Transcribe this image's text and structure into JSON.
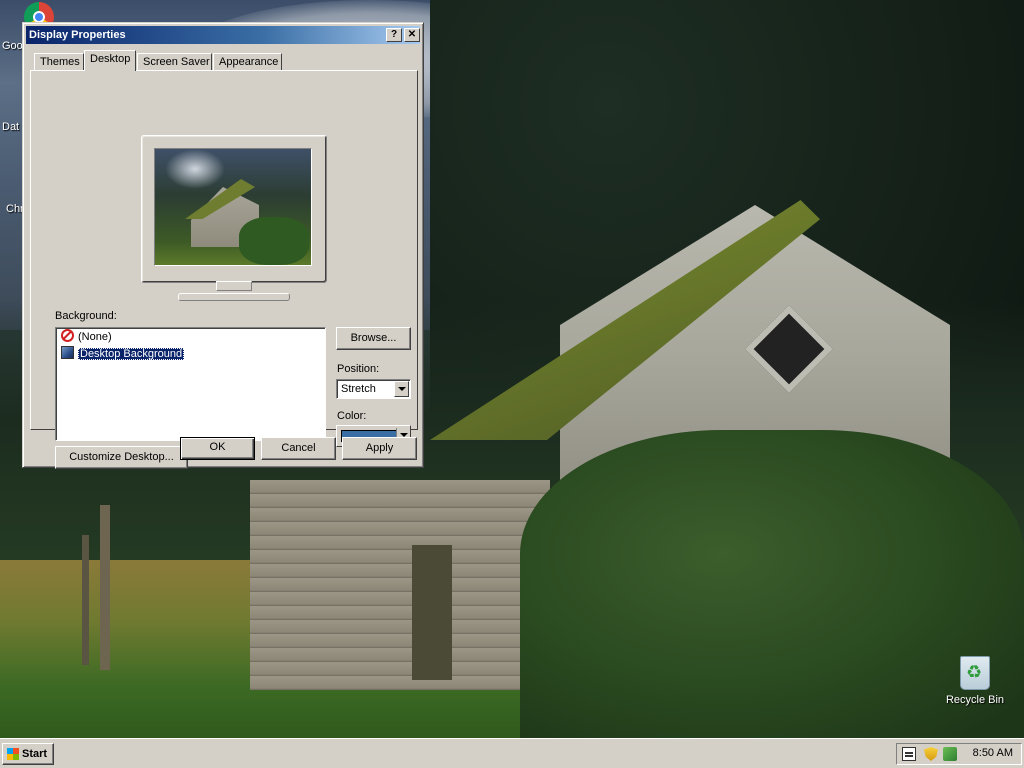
{
  "desktop": {
    "icons": [
      {
        "label": "Goo"
      },
      {
        "label": "Dat"
      },
      {
        "label": "Chr"
      }
    ],
    "recycle_bin": "Recycle Bin"
  },
  "dialog": {
    "title": "Display Properties",
    "help_glyph": "?",
    "close_glyph": "✕",
    "tabs": [
      "Themes",
      "Desktop",
      "Screen Saver",
      "Appearance"
    ],
    "active_tab": "Desktop",
    "background_label": "Background:",
    "background_items": [
      "(None)",
      "Desktop Background"
    ],
    "selected_background": "Desktop Background",
    "browse_label": "Browse...",
    "position_label": "Position:",
    "position_value": "Stretch",
    "color_label": "Color:",
    "color_value": "#3a6ea5",
    "customize_label": "Customize Desktop...",
    "ok_label": "OK",
    "cancel_label": "Cancel",
    "apply_label": "Apply"
  },
  "taskbar": {
    "start_label": "Start",
    "clock": "8:50 AM",
    "tray_icons": [
      "keyboard-icon",
      "security-shield-icon",
      "network-icon"
    ]
  }
}
